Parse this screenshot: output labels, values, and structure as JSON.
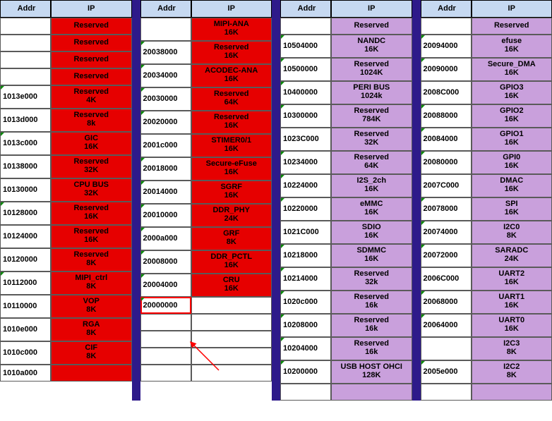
{
  "headers": {
    "addr": "Addr",
    "ip": "IP"
  },
  "highlight_addr": "20000000",
  "panes": [
    {
      "rows": [
        {
          "addr": "",
          "name": "Reserved",
          "size": "",
          "color": "red",
          "mark": false
        },
        {
          "addr": "",
          "name": "Reserved",
          "size": "",
          "color": "red",
          "mark": false
        },
        {
          "addr": "",
          "name": "Reserved",
          "size": "",
          "color": "red",
          "mark": false
        },
        {
          "addr": "",
          "name": "Reserved",
          "size": "",
          "color": "red",
          "mark": false
        },
        {
          "addr": "1013e000",
          "name": "Reserved",
          "size": "4K",
          "color": "red",
          "mark": true
        },
        {
          "addr": "1013d000",
          "name": "Reserved",
          "size": "8k",
          "color": "red",
          "mark": false
        },
        {
          "addr": "1013c000",
          "name": "GIC",
          "size": "16K",
          "color": "red",
          "mark": true
        },
        {
          "addr": "10138000",
          "name": "Reserved",
          "size": "32K",
          "color": "red",
          "mark": false
        },
        {
          "addr": "10130000",
          "name": "CPU BUS",
          "size": "32K",
          "color": "red",
          "mark": false
        },
        {
          "addr": "10128000",
          "name": "Reserved",
          "size": "16K",
          "color": "red",
          "mark": true
        },
        {
          "addr": "10124000",
          "name": "Reserved",
          "size": "16K",
          "color": "red",
          "mark": false
        },
        {
          "addr": "10120000",
          "name": "Reserved",
          "size": "8K",
          "color": "red",
          "mark": false
        },
        {
          "addr": "10112000",
          "name": "MIPI_ctrl",
          "size": "8K",
          "color": "red",
          "mark": true
        },
        {
          "addr": "10110000",
          "name": "VOP",
          "size": "8K",
          "color": "red",
          "mark": false
        },
        {
          "addr": "1010e000",
          "name": "RGA",
          "size": "8K",
          "color": "red",
          "mark": false
        },
        {
          "addr": "1010c000",
          "name": "CIF",
          "size": "8K",
          "color": "red",
          "mark": false
        },
        {
          "addr": "1010a000",
          "name": "",
          "size": "",
          "color": "red",
          "mark": false
        }
      ]
    },
    {
      "rows": [
        {
          "addr": "",
          "name": "MIPI-ANA",
          "size": "16K",
          "color": "red",
          "mark": false
        },
        {
          "addr": "20038000",
          "name": "Reserved",
          "size": "16K",
          "color": "red",
          "mark": true
        },
        {
          "addr": "20034000",
          "name": "ACODEC-ANA",
          "size": "16K",
          "color": "red",
          "mark": true
        },
        {
          "addr": "20030000",
          "name": "Reserved",
          "size": "64K",
          "color": "red",
          "mark": true
        },
        {
          "addr": "20020000",
          "name": "Reserved",
          "size": "16K",
          "color": "red",
          "mark": true
        },
        {
          "addr": "2001c000",
          "name": "STIMER0/1",
          "size": "16K",
          "color": "red",
          "mark": false
        },
        {
          "addr": "20018000",
          "name": "Secure-eFuse",
          "size": "16K",
          "color": "red",
          "mark": true
        },
        {
          "addr": "20014000",
          "name": "SGRF",
          "size": "16K",
          "color": "red",
          "mark": true
        },
        {
          "addr": "20010000",
          "name": "DDR_PHY",
          "size": "24K",
          "color": "red",
          "mark": true
        },
        {
          "addr": "2000a000",
          "name": "GRF",
          "size": "8K",
          "color": "red",
          "mark": true
        },
        {
          "addr": "20008000",
          "name": "DDR_PCTL",
          "size": "16K",
          "color": "red",
          "mark": true
        },
        {
          "addr": "20004000",
          "name": "CRU",
          "size": "16K",
          "color": "red",
          "mark": true
        },
        {
          "addr": "20000000",
          "name": "",
          "size": "",
          "color": "white",
          "mark": true,
          "hl": true
        },
        {
          "addr": "",
          "name": "",
          "size": "",
          "color": "white",
          "mark": false
        },
        {
          "addr": "",
          "name": "",
          "size": "",
          "color": "white",
          "mark": false
        },
        {
          "addr": "",
          "name": "",
          "size": "",
          "color": "white",
          "mark": false
        },
        {
          "addr": "",
          "name": "",
          "size": "",
          "color": "white",
          "mark": false
        }
      ]
    },
    {
      "rows": [
        {
          "addr": "",
          "name": "Reserved",
          "size": "",
          "color": "purple",
          "mark": false
        },
        {
          "addr": "10504000",
          "name": "NANDC",
          "size": "16K",
          "color": "purple",
          "mark": true
        },
        {
          "addr": "10500000",
          "name": "Reserved",
          "size": "1024K",
          "color": "purple",
          "mark": true
        },
        {
          "addr": "10400000",
          "name": "PERI BUS",
          "size": "1024k",
          "color": "purple",
          "mark": true
        },
        {
          "addr": "10300000",
          "name": "Reserved",
          "size": "784K",
          "color": "purple",
          "mark": true
        },
        {
          "addr": "1023C000",
          "name": "Reserved",
          "size": "32K",
          "color": "purple",
          "mark": false
        },
        {
          "addr": "10234000",
          "name": "Reserved",
          "size": "64K",
          "color": "purple",
          "mark": true
        },
        {
          "addr": "10224000",
          "name": "I2S_2ch",
          "size": "16K",
          "color": "purple",
          "mark": true
        },
        {
          "addr": "10220000",
          "name": "eMMC",
          "size": "16K",
          "color": "purple",
          "mark": true
        },
        {
          "addr": "1021C000",
          "name": "SDIO",
          "size": "16K",
          "color": "purple",
          "mark": false
        },
        {
          "addr": "10218000",
          "name": "SDMMC",
          "size": "16K",
          "color": "purple",
          "mark": true
        },
        {
          "addr": "10214000",
          "name": "Reserved",
          "size": "32k",
          "color": "purple",
          "mark": true
        },
        {
          "addr": "1020c000",
          "name": "Reserved",
          "size": "16k",
          "color": "purple",
          "mark": true
        },
        {
          "addr": "10208000",
          "name": "Reserved",
          "size": "16k",
          "color": "purple",
          "mark": true
        },
        {
          "addr": "10204000",
          "name": "Reserved",
          "size": "16k",
          "color": "purple",
          "mark": true
        },
        {
          "addr": "10200000",
          "name": "USB HOST OHCI",
          "size": "128K",
          "color": "purple",
          "mark": true
        },
        {
          "addr": "",
          "name": "",
          "size": "",
          "color": "purple",
          "mark": false
        }
      ]
    },
    {
      "rows": [
        {
          "addr": "",
          "name": "Reserved",
          "size": "",
          "color": "purple",
          "mark": false
        },
        {
          "addr": "20094000",
          "name": "efuse",
          "size": "16K",
          "color": "purple",
          "mark": true
        },
        {
          "addr": "20090000",
          "name": "Secure_DMA",
          "size": "16K",
          "color": "purple",
          "mark": true
        },
        {
          "addr": "2008C000",
          "name": "GPIO3",
          "size": "16K",
          "color": "purple",
          "mark": false
        },
        {
          "addr": "20088000",
          "name": "GPIO2",
          "size": "16K",
          "color": "purple",
          "mark": true
        },
        {
          "addr": "20084000",
          "name": "GPIO1",
          "size": "16K",
          "color": "purple",
          "mark": true
        },
        {
          "addr": "20080000",
          "name": "GPI0",
          "size": "16K",
          "color": "purple",
          "mark": true
        },
        {
          "addr": "2007C000",
          "name": "DMAC",
          "size": "16K",
          "color": "purple",
          "mark": false
        },
        {
          "addr": "20078000",
          "name": "SPI",
          "size": "16K",
          "color": "purple",
          "mark": true
        },
        {
          "addr": "20074000",
          "name": "I2C0",
          "size": "8K",
          "color": "purple",
          "mark": true
        },
        {
          "addr": "20072000",
          "name": "SARADC",
          "size": "24K",
          "color": "purple",
          "mark": true
        },
        {
          "addr": "2006C000",
          "name": "UART2",
          "size": "16K",
          "color": "purple",
          "mark": false
        },
        {
          "addr": "20068000",
          "name": "UART1",
          "size": "16K",
          "color": "purple",
          "mark": true
        },
        {
          "addr": "20064000",
          "name": "UART0",
          "size": "16K",
          "color": "purple",
          "mark": true
        },
        {
          "addr": "",
          "name": "I2C3",
          "size": "8K",
          "color": "purple",
          "mark": false
        },
        {
          "addr": "2005e000",
          "name": "I2C2",
          "size": "8K",
          "color": "purple",
          "mark": true
        },
        {
          "addr": "",
          "name": "",
          "size": "",
          "color": "purple",
          "mark": false
        }
      ]
    }
  ]
}
